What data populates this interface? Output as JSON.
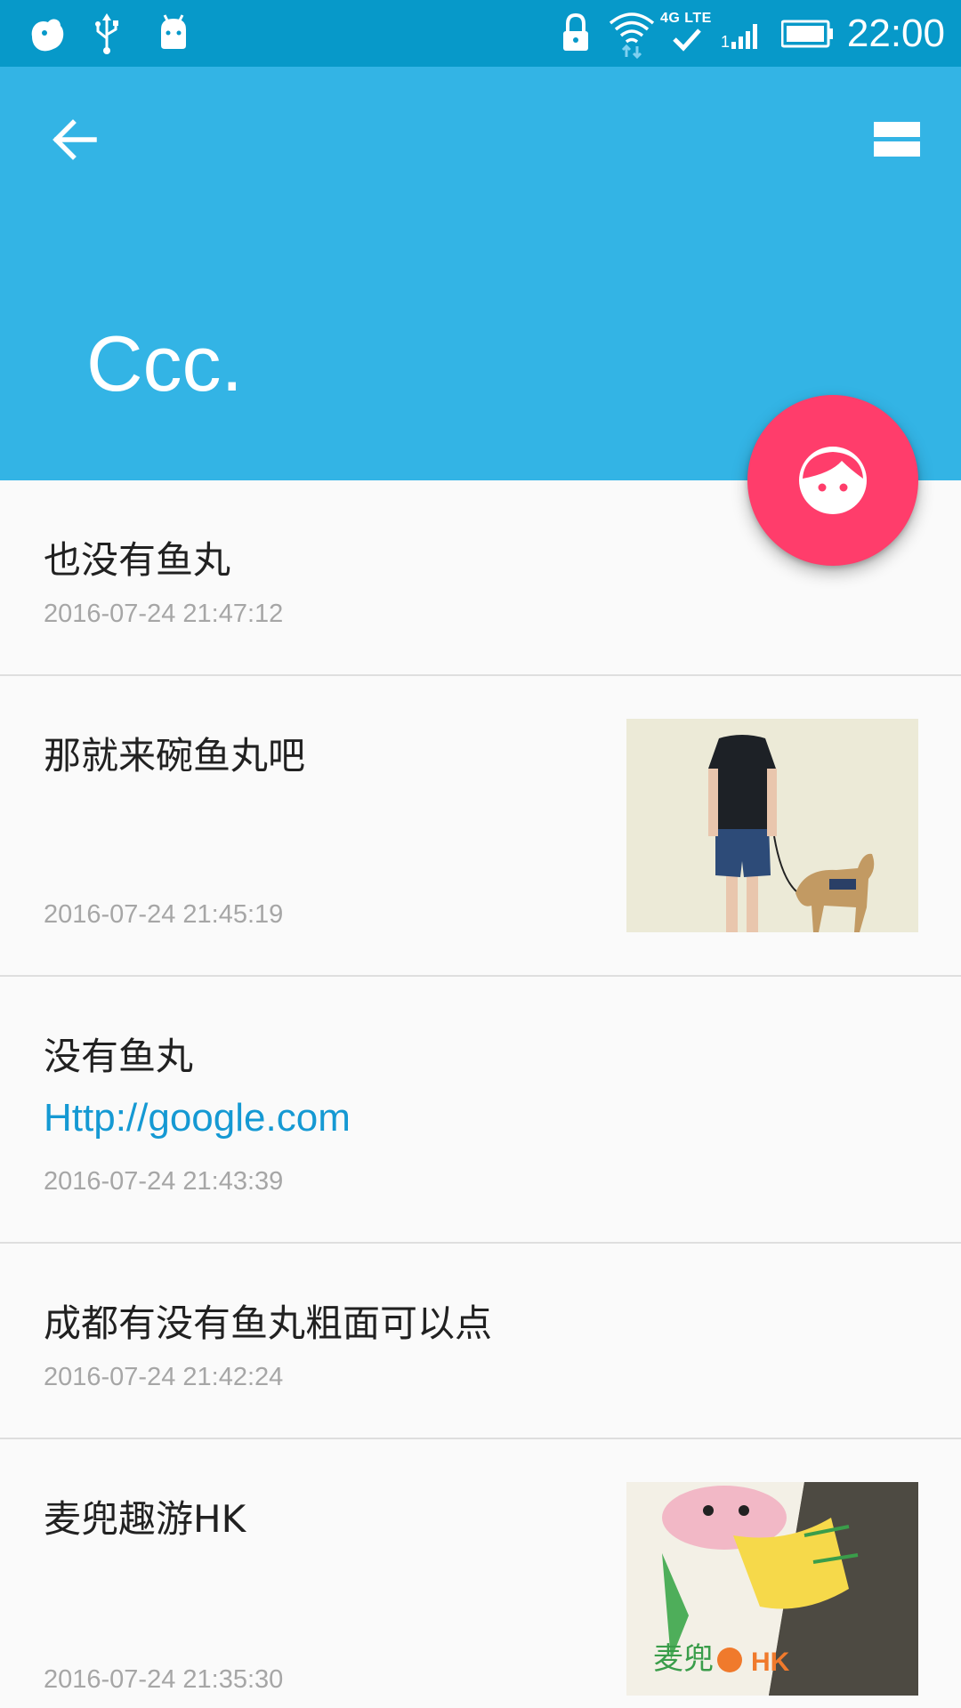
{
  "status_bar": {
    "time": "22:00",
    "network_label": "4G LTE",
    "icons": [
      "notification-blob-icon",
      "usb-icon",
      "android-debug-icon",
      "lock-icon",
      "wifi-icon",
      "signal-icon",
      "battery-icon"
    ]
  },
  "app_bar": {
    "title": "Ccc.",
    "back_icon": "arrow-back-icon",
    "view_icon": "view-list-icon",
    "color": "#33b4e5"
  },
  "fab": {
    "icon": "face-icon",
    "color": "#ff3d6b"
  },
  "entries": [
    {
      "title": "也没有鱼丸",
      "date": "2016-07-24 21:47:12"
    },
    {
      "title": "那就来碗鱼丸吧",
      "date": "2016-07-24 21:45:19",
      "image": "man-walking-dog-illustration"
    },
    {
      "title": "没有鱼丸",
      "link": "Http://google.com",
      "date": "2016-07-24 21:43:39"
    },
    {
      "title": "成都有没有鱼丸粗面可以点",
      "date": "2016-07-24 21:42:24"
    },
    {
      "title": "麦兜趣游HK",
      "date": "2016-07-24 21:35:30",
      "image": "mcdull-cup-photo"
    }
  ]
}
